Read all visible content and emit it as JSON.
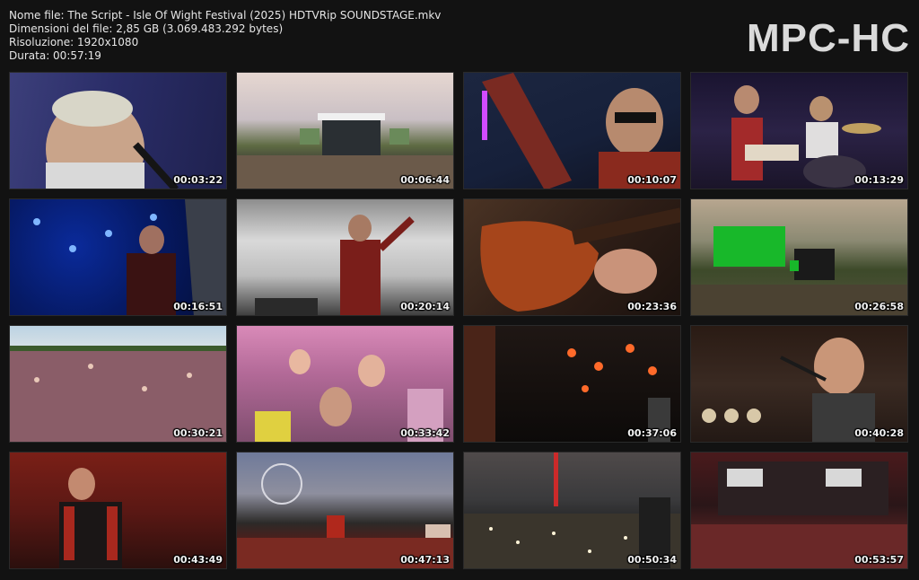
{
  "info": {
    "filename": "Nome file: The Script - Isle Of Wight Festival (2025) HDTVRip SOUNDSTAGE.mkv",
    "filesize": "Dimensioni del file: 2,85 GB (3.069.483.292 bytes)",
    "resolution": "Risoluzione: 1920x1080",
    "duration": "Durata: 00:57:19"
  },
  "logo": "MPC-HC",
  "thumbnails": [
    {
      "timestamp": "00:03:22"
    },
    {
      "timestamp": "00:06:44"
    },
    {
      "timestamp": "00:10:07"
    },
    {
      "timestamp": "00:13:29"
    },
    {
      "timestamp": "00:16:51"
    },
    {
      "timestamp": "00:20:14"
    },
    {
      "timestamp": "00:23:36"
    },
    {
      "timestamp": "00:26:58"
    },
    {
      "timestamp": "00:30:21"
    },
    {
      "timestamp": "00:33:42"
    },
    {
      "timestamp": "00:37:06"
    },
    {
      "timestamp": "00:40:28"
    },
    {
      "timestamp": "00:43:49"
    },
    {
      "timestamp": "00:47:13"
    },
    {
      "timestamp": "00:50:34"
    },
    {
      "timestamp": "00:53:57"
    }
  ]
}
